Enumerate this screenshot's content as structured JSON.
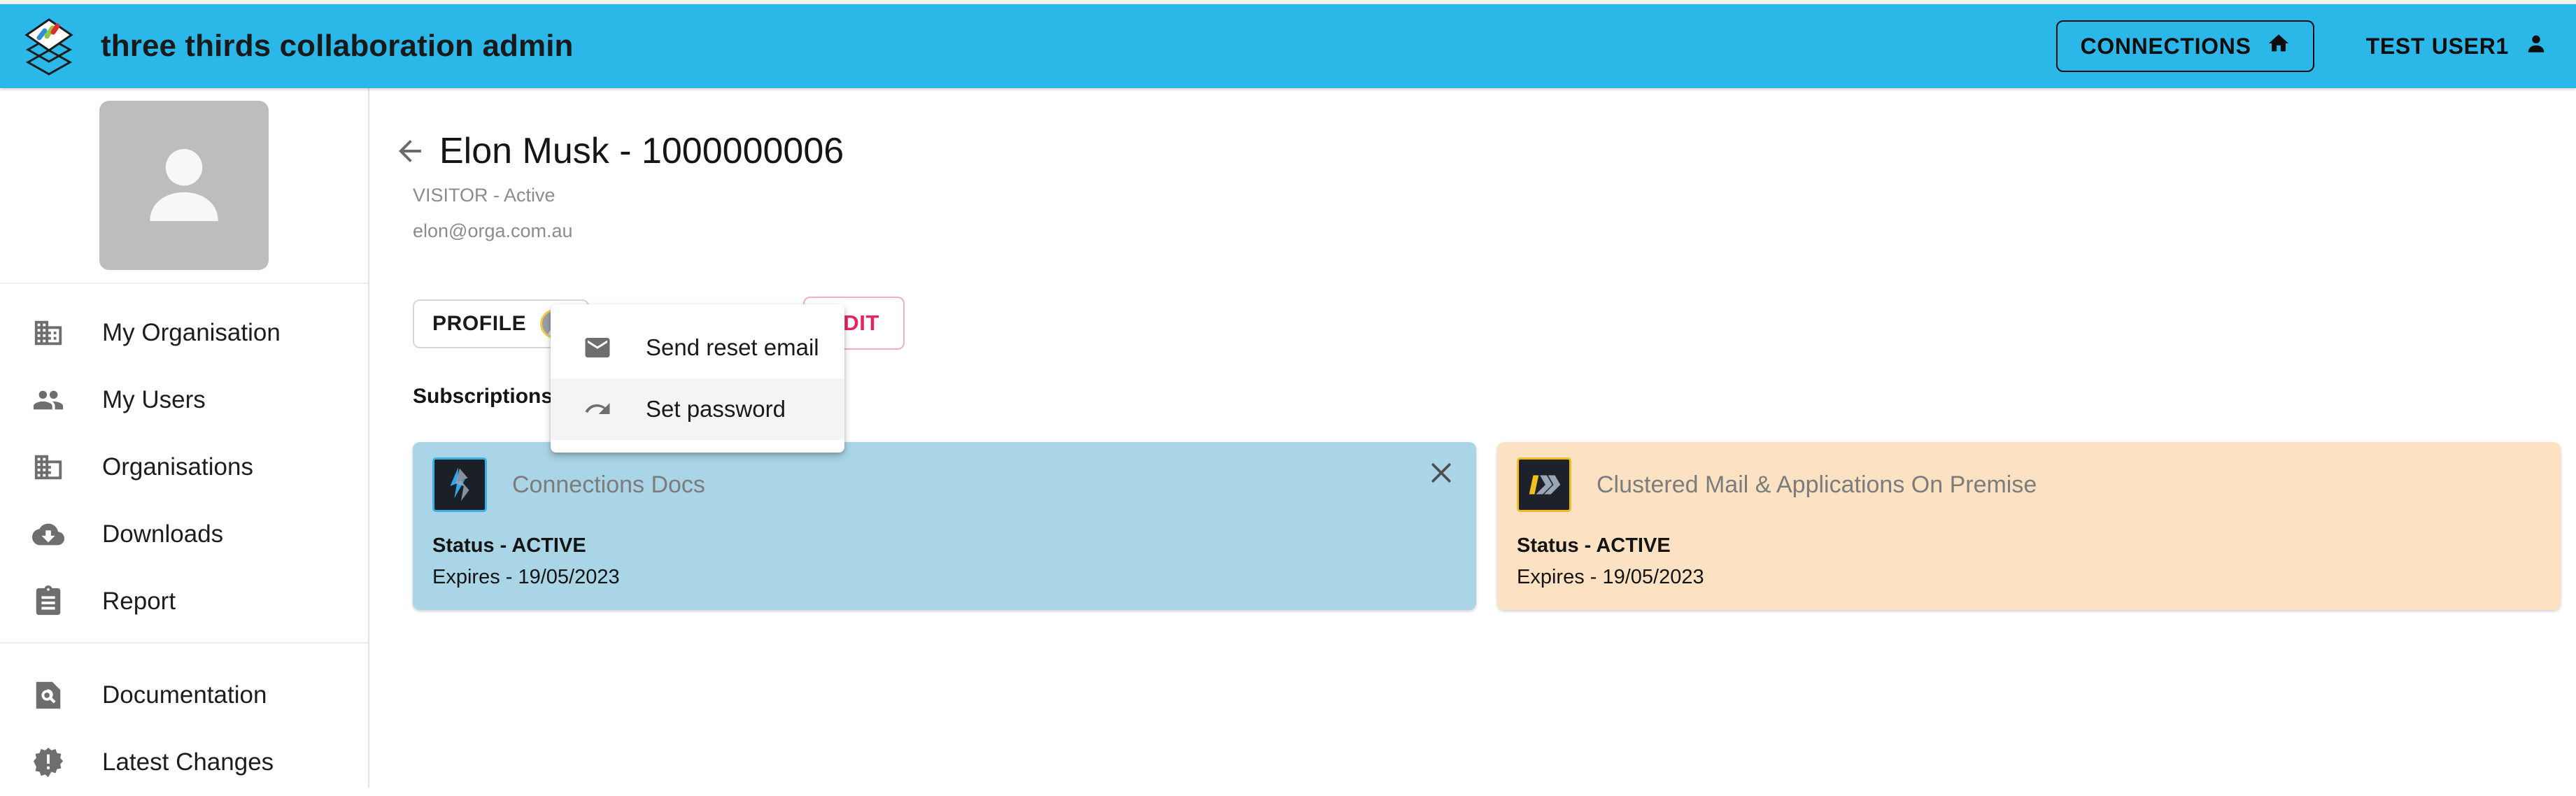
{
  "header": {
    "brand_title": "three thirds collaboration admin",
    "logo_icon": "stacked-diamonds-logo",
    "connections_label": "CONNECTIONS",
    "connections_icon": "home-icon",
    "user_label": "TEST USER1",
    "user_icon": "person-icon",
    "background_color": "#2BB8E8"
  },
  "sidebar": {
    "avatar_icon": "person-placeholder-icon",
    "groups": [
      {
        "items": [
          {
            "label": "My Organisation",
            "icon": "business-icon"
          },
          {
            "label": "My Users",
            "icon": "people-icon"
          },
          {
            "label": "Organisations",
            "icon": "domain-icon"
          },
          {
            "label": "Downloads",
            "icon": "cloud-download-icon"
          },
          {
            "label": "Report",
            "icon": "clipboard-icon"
          }
        ]
      },
      {
        "items": [
          {
            "label": "Documentation",
            "icon": "document-search-icon"
          },
          {
            "label": "Latest Changes",
            "icon": "badge-alert-icon"
          }
        ]
      }
    ]
  },
  "main": {
    "back_icon": "arrow-left-icon",
    "title": "Elon Musk - 1000000006",
    "subtitle": "VISITOR - Active",
    "email": "elon@orga.com.au",
    "profile_button": "PROFILE",
    "profile_button_icon": "avatar-icon",
    "edit_button": "EDIT",
    "section_title": "Subscriptions"
  },
  "dropdown": {
    "items": [
      {
        "label": "Send reset email",
        "icon": "mail-icon",
        "hovered": false
      },
      {
        "label": "Set password",
        "icon": "redo-arrow-icon",
        "hovered": true
      }
    ]
  },
  "subscriptions": [
    {
      "name": "Connections Docs",
      "status": "Status - ACTIVE",
      "expires": "Expires - 19/05/2023",
      "logo_icon": "connections-docs-logo",
      "background_color": "#A9D5E6",
      "has_close": true,
      "close_icon": "close-icon"
    },
    {
      "name": "Clustered Mail & Applications On Premise",
      "status": "Status - ACTIVE",
      "expires": "Expires - 19/05/2023",
      "logo_icon": "clustered-mail-logo",
      "background_color": "#FCE2C2",
      "has_close": false,
      "close_icon": ""
    }
  ]
}
